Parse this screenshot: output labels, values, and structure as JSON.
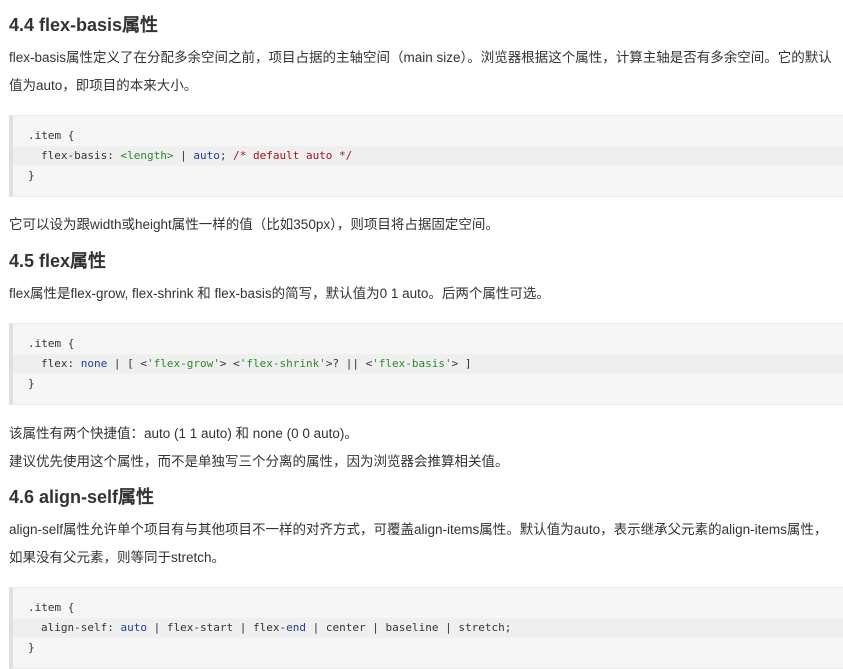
{
  "section_44": {
    "heading": "4.4 flex-basis属性",
    "para1": "flex-basis属性定义了在分配多余空间之前，项目占据的主轴空间（main size）。浏览器根据这个属性，计算主轴是否有多余空间。它的默认值为auto，即项目的本来大小。",
    "code": {
      "l1": ".item {",
      "prop": "flex-basis",
      "colon": ": ",
      "length": "<length>",
      "sep1": " | ",
      "auto": "auto",
      "semi": "; ",
      "comment": "/* default auto */",
      "l3": "}"
    },
    "para2": "它可以设为跟width或height属性一样的值（比如350px），则项目将占据固定空间。"
  },
  "section_45": {
    "heading": "4.5 flex属性",
    "para1": "flex属性是flex-grow, flex-shrink 和 flex-basis的简写，默认值为0 1 auto。后两个属性可选。",
    "code": {
      "l1": ".item {",
      "prop": "flex",
      "colon": ": ",
      "none": "none",
      "rest1": " | [ <",
      "grow": "'flex-grow'",
      "rest2": "> <",
      "shrink": "'flex-shrink'",
      "rest3": ">? || <",
      "basis": "'flex-basis'",
      "rest4": "> ]",
      "l3": "}"
    },
    "para2": "该属性有两个快捷值：auto (1 1 auto) 和 none (0 0 auto)。",
    "para3": "建议优先使用这个属性，而不是单独写三个分离的属性，因为浏览器会推算相关值。"
  },
  "section_46": {
    "heading": "4.6 align-self属性",
    "para1": "align-self属性允许单个项目有与其他项目不一样的对齐方式，可覆盖align-items属性。默认值为auto，表示继承父元素的align-items属性，如果没有父元素，则等同于stretch。",
    "code": {
      "l1": ".item {",
      "prop": "align-self",
      "colon": ": ",
      "auto": "auto",
      "sep": " | ",
      "start": "flex-start",
      "end_a": "flex-",
      "end_b": "end",
      "center": "center",
      "baseline": "baseline",
      "stretch": "stretch",
      "semi": ";",
      "l3": "}"
    }
  }
}
